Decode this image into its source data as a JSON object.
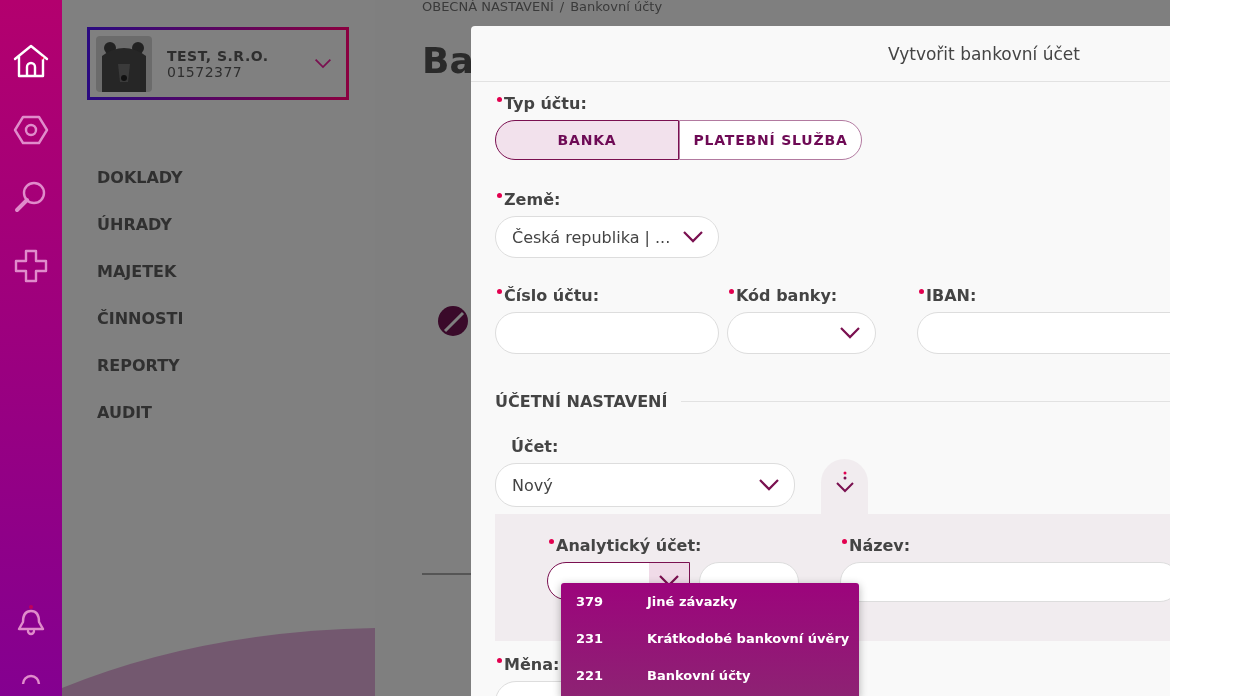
{
  "rail": [
    {
      "kind": "home",
      "selected": true
    },
    {
      "kind": "hexagon",
      "selected": false
    },
    {
      "kind": "search",
      "selected": false
    },
    {
      "kind": "plus",
      "selected": false
    },
    {
      "kind": "bell",
      "selected": false
    },
    {
      "kind": "user",
      "selected": false
    }
  ],
  "company": {
    "name": "TEST, S.R.O.",
    "id": "01572377"
  },
  "nav": [
    "DOKLADY",
    "ÚHRADY",
    "MAJETEK",
    "ČINNOSTI",
    "REPORTY",
    "AUDIT"
  ],
  "breadcrumb": {
    "section": "OBECNÁ NASTAVENÍ",
    "separator": "/",
    "page": "Bankovní účty"
  },
  "page_title": "Ba",
  "modal": {
    "title": "Vytvořit bankovní účet",
    "type_label": {
      "text": "Typ účtu:",
      "required": true
    },
    "type_options": [
      {
        "label": "BANKA",
        "selected": true
      },
      {
        "label": "PLATEBNÍ SLUŽBA",
        "selected": false
      }
    ],
    "country_label": {
      "text": "Země:",
      "required": true
    },
    "country_value": "Česká republika | ...",
    "account_number_label": {
      "text": "Číslo účtu:",
      "required": true
    },
    "bank_code_label": {
      "text": "Kód banky:",
      "required": true
    },
    "iban_label": {
      "text": "IBAN:",
      "required": true
    },
    "section_heading": "ÚČETNÍ NASTAVENÍ",
    "account_label": {
      "text": "Účet:",
      "required": false
    },
    "account_value": "Nový",
    "analytic_label": {
      "text": "Analytický účet:",
      "required": true
    },
    "name_label": {
      "text": "Název:",
      "required": true
    },
    "currency_label": {
      "text": "Měna:",
      "required": true
    }
  },
  "dropdown": [
    {
      "code": "379",
      "name": "Jiné závazky"
    },
    {
      "code": "231",
      "name": "Krátkodobé bankovní úvěry"
    },
    {
      "code": "221",
      "name": "Bankovní účty"
    }
  ]
}
